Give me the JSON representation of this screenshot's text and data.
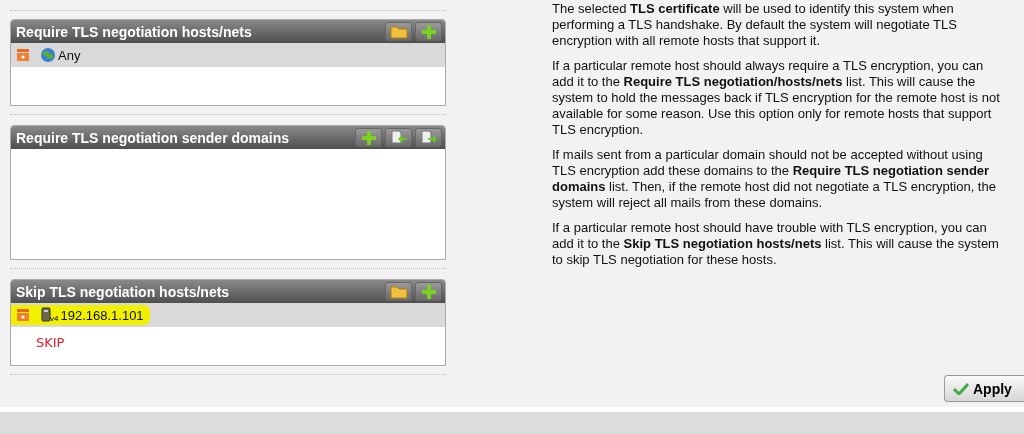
{
  "panels": [
    {
      "title": "Require TLS negotiation hosts/nets",
      "buttons": [
        {
          "kind": "folder"
        },
        {
          "kind": "add"
        }
      ],
      "items": [
        {
          "kind": "network",
          "label": "Any",
          "highlighted": false
        }
      ]
    },
    {
      "title": "Require TLS negotiation sender domains",
      "buttons": [
        {
          "kind": "add"
        },
        {
          "kind": "import"
        },
        {
          "kind": "export"
        }
      ],
      "items": [
        {
          "kind": "none"
        }
      ]
    },
    {
      "title": "Skip TLS negotiation hosts/nets",
      "buttons": [
        {
          "kind": "folder"
        },
        {
          "kind": "add"
        }
      ],
      "items": [
        {
          "kind": "host",
          "label": "192.168.1.101",
          "badge": "v4",
          "highlighted": true
        }
      ],
      "annotation": "SKIP"
    }
  ],
  "help": [
    "The selected **TLS certificate** will be used to identify this system when performing a TLS handshake. By default the system will negotiate TLS encryption with all remote hosts that support it.",
    "If a particular remote host should always require a TLS encryption, you can add it to the **Require TLS negotiation/hosts/nets** list. This will cause the system to hold the messages back if TLS encryption for the remote host is not available for some reason. Use this option only for remote hosts that support TLS encryption.",
    "If mails sent from a particular domain should not be accepted without using TLS encryption add these domains to the **Require TLS negotiation sender domains** list. Then, if the remote host did not negotiate a TLS encryption, the system will reject all mails from these domains.",
    "If a particular remote host should have trouble with TLS encryption, you can add it to the **Skip TLS negotiation hosts/nets** list. This will cause the system to skip TLS negotiation for these hosts."
  ],
  "apply": {
    "label": "Apply"
  }
}
